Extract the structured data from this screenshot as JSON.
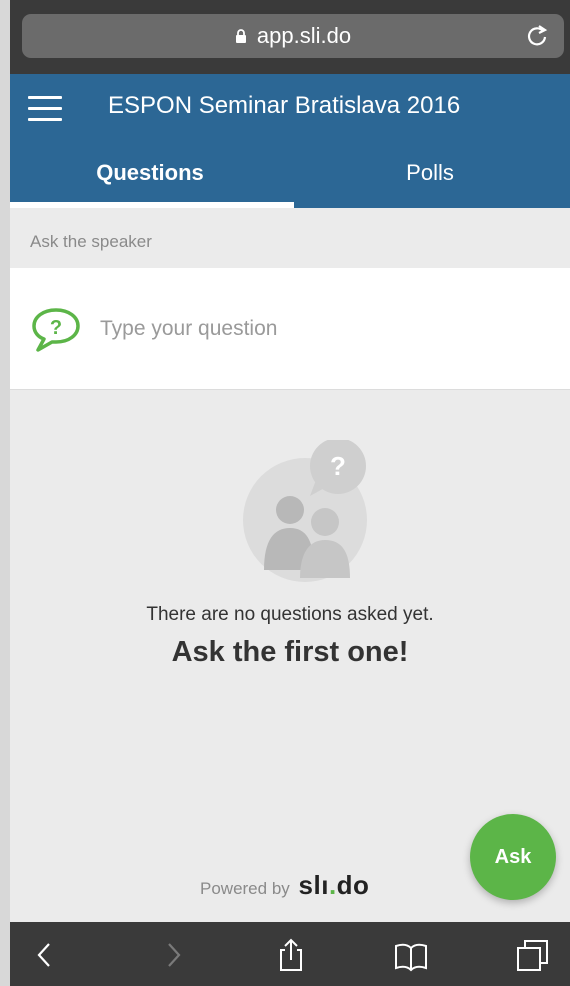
{
  "browser": {
    "url": "app.sli.do",
    "icons": [
      "lock-icon",
      "reload-icon"
    ]
  },
  "header": {
    "title": "ESPON Seminar Bratislava 2016",
    "menu_icon": "hamburger-menu-icon",
    "tabs": [
      {
        "label": "Questions",
        "active": true
      },
      {
        "label": "Polls",
        "active": false
      }
    ]
  },
  "ask": {
    "section_label": "Ask the speaker",
    "placeholder": "Type your question",
    "icon": "question-bubble-icon"
  },
  "empty_state": {
    "message": "There are no questions asked yet.",
    "cta": "Ask the first one!",
    "illustration": "people-question-illustration"
  },
  "footer": {
    "powered_by": "Powered by",
    "brand_main": "slı",
    "brand_dot": ".",
    "brand_end": "do"
  },
  "fab": {
    "label": "Ask"
  },
  "toolbar": {
    "icons": [
      "back-icon",
      "forward-icon",
      "share-icon",
      "bookmarks-icon",
      "tabs-icon"
    ]
  },
  "colors": {
    "header_bg": "#2c6795",
    "accent_green": "#5cb548",
    "page_bg": "#ebebeb",
    "browser_chrome": "#3a3a3a"
  }
}
